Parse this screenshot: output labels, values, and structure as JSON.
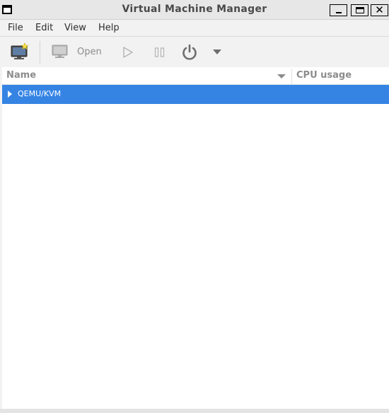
{
  "window": {
    "title": "Virtual Machine Manager"
  },
  "menubar": {
    "items": [
      {
        "label": "File"
      },
      {
        "label": "Edit"
      },
      {
        "label": "View"
      },
      {
        "label": "Help"
      }
    ]
  },
  "toolbar": {
    "new_vm_icon": "monitor-new-icon",
    "open_icon": "monitor-icon",
    "open_label": "Open",
    "run_icon": "play-icon",
    "pause_icon": "pause-icon",
    "shutdown_icon": "power-icon",
    "shutdown_menu_icon": "chevron-down-icon"
  },
  "columns": {
    "name": "Name",
    "cpu": "CPU usage"
  },
  "connections": [
    {
      "label": "QEMU/KVM",
      "selected": true,
      "expanded": false
    }
  ],
  "colors": {
    "selection": "#3584e4",
    "disabled_text": "#8c8c8c"
  }
}
